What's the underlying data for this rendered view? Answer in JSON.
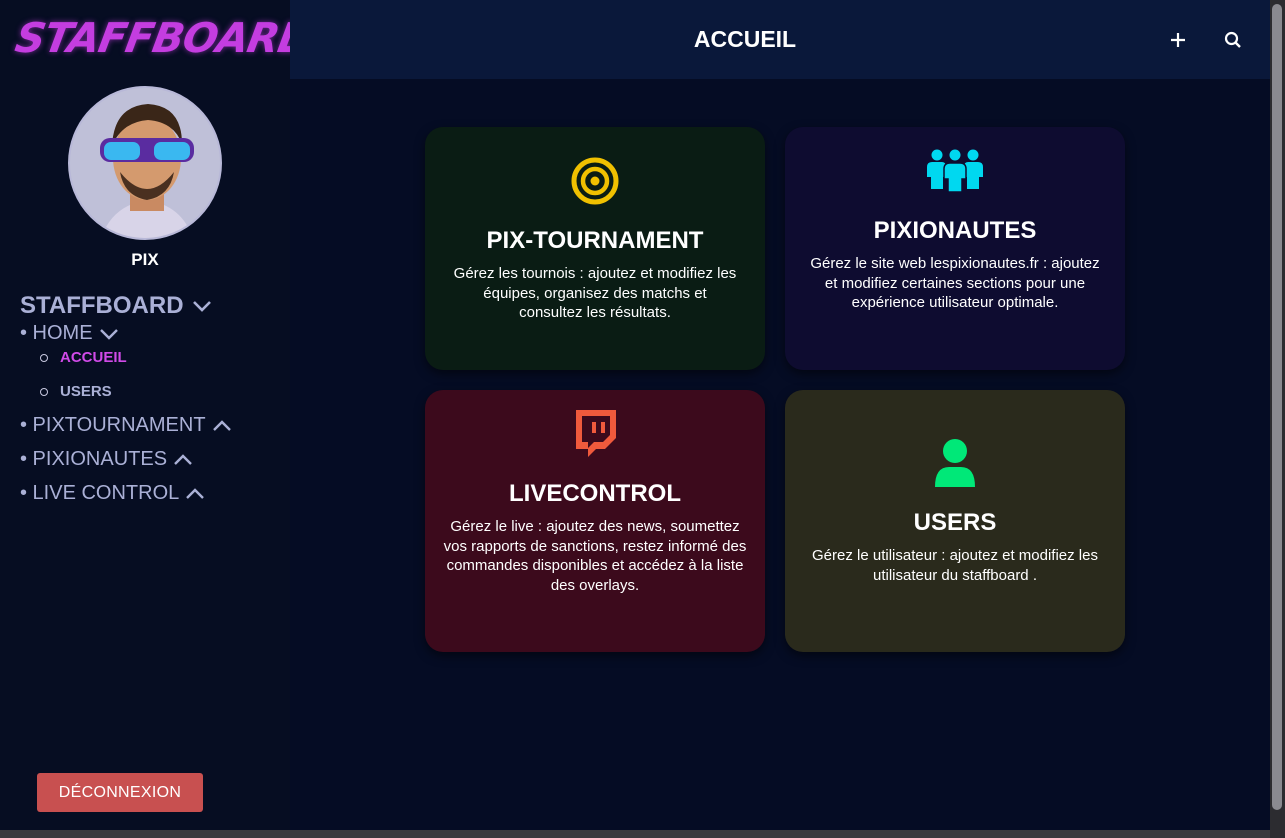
{
  "sidebar": {
    "logo_text": "STAFFBOARD",
    "user_name": "PIX",
    "section_label": "STAFFBOARD",
    "items": [
      {
        "label": "• HOME"
      },
      {
        "label": "• PIXTOURNAMENT"
      },
      {
        "label": "• PIXIONAUTES"
      },
      {
        "label": "• LIVE CONTROL"
      }
    ],
    "subitems": [
      {
        "label": "ACCUEIL"
      },
      {
        "label": "USERS"
      }
    ],
    "logout_label": "DÉCONNEXION"
  },
  "header": {
    "title": "ACCUEIL"
  },
  "cards": [
    {
      "title": "PIX-TOURNAMENT",
      "description": "Gérez les tournois : ajoutez et modifiez les équipes, organisez des matchs et consultez les résultats."
    },
    {
      "title": "PIXIONAUTES",
      "description": "Gérez le site web lespixionautes.fr : ajoutez et modifiez certaines sections pour une expérience utilisateur optimale."
    },
    {
      "title": "LIVECONTROL",
      "description": "Gérez le live : ajoutez des news, soumettez vos rapports de sanctions, restez informé des commandes disponibles et accédez à la liste des overlays."
    },
    {
      "title": "USERS",
      "description": "Gérez le utilisateur : ajoutez et modifiez les utilisateur du staffboard ."
    }
  ],
  "colors": {
    "active_nav": "#d04ae8",
    "logout_bg": "#c85050",
    "tournament_card": "#0a1c14",
    "pixionautes_card": "#0e0c30",
    "livecontrol_card": "#3c0a1c",
    "users_card": "#2a2a1c",
    "target_icon": "#f0c000",
    "group_icon": "#00d8f0",
    "twitch_icon": "#f05a3c",
    "user_icon": "#00e878"
  },
  "icons": {
    "tournament": "target-icon",
    "pixionautes": "group-icon",
    "livecontrol": "twitch-icon",
    "users": "user-icon",
    "add": "plus-icon",
    "search": "search-icon"
  }
}
